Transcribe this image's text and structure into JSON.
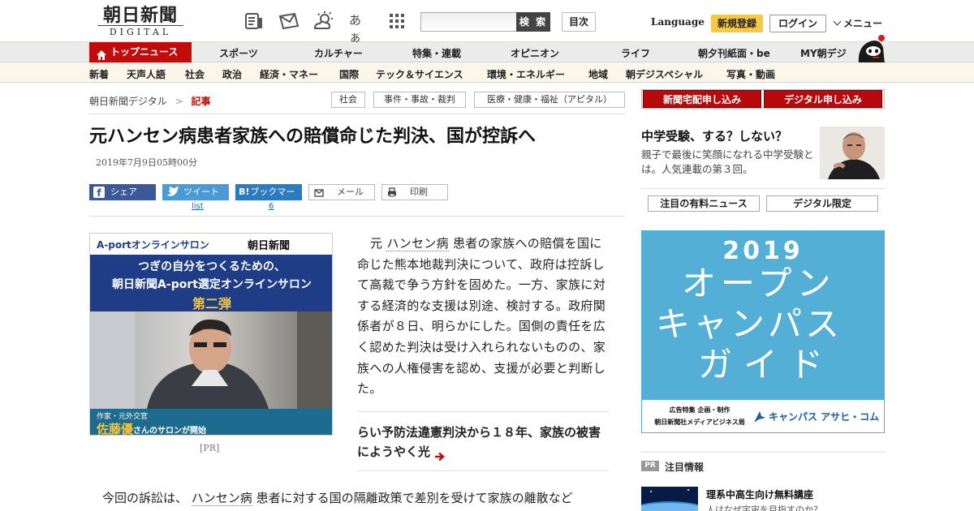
{
  "brand": {
    "logo_main": "朝日新聞",
    "logo_sub": "DIGITAL"
  },
  "header": {
    "icons": [
      "newspaper-icon",
      "mail-icon",
      "weather-icon",
      "font-size-icon",
      "grid-icon"
    ],
    "font_glyph": "あぁ",
    "search_placeholder": "",
    "search_label": "検 索",
    "toc_label": "目次",
    "language_label": "Language",
    "signup_label": "新規登録",
    "login_label": "ログイン",
    "menu_label": "メニュー"
  },
  "nav_primary": {
    "top_label": "トップニュース",
    "items": [
      "スポーツ",
      "カルチャー",
      "特集・連載",
      "オピニオン",
      "ライフ",
      "朝夕刊紙面・be",
      "MY朝デジ"
    ]
  },
  "nav_secondary": {
    "items": [
      "新着",
      "天声人語",
      "社会",
      "政治",
      "経済・マネー",
      "国際",
      "テック＆サイエンス",
      "環境・エネルギー",
      "地域",
      "朝デジスペシャル",
      "写真・動画"
    ]
  },
  "breadcrumb": {
    "home": "朝日新聞デジタル",
    "sep": ">",
    "current": "記事"
  },
  "tags": [
    "社会",
    "事件・事故・裁判",
    "医療・健康・福祉（アピタル）"
  ],
  "article": {
    "headline": "元ハンセン病患者家族への賠償命じた判決、国が控訴へ",
    "date": "2019年7月9日05時00分",
    "share": {
      "facebook": "シェア",
      "twitter": "ツイート",
      "twitter_sub": "list",
      "hatena": "ブックマーク",
      "hatena_badge": "B!",
      "hatena_sub": "6",
      "mail": "メール",
      "print": "印刷"
    },
    "body_pre": "元",
    "body_keyword": "ハンセン病",
    "body_rest": "患者の家族への賠償を国に命じた熊本地裁判決について、政府は控訴して高裁で争う方針を固めた。一方、家族に対する経済的な支援は別途、検討する。政府関係者が８日、明らかにした。国側の責任を広く認めた判決は受け入れられないものの、家族への人権侵害を認め、支援が必要と判断した。",
    "related": "らい予防法違憲判決から１８年、家族の被害にようやく光",
    "para2_pre": "今回の訴訟は、",
    "para2_keyword": "ハンセン病",
    "para2_rest": "患者に対する国の隔離政策で差別を受けて家族の離散など"
  },
  "ad_left": {
    "brand_left": "A-portオンラインサロン",
    "brand_right": "朝日新聞",
    "line1": "つぎの自分をつくるための、",
    "line2": "朝日新聞A-port選定オンラインサロン",
    "line3": "第二弾",
    "caption_small": "作家・元外交官",
    "caption_name": "佐藤優",
    "caption_rest": "さんのサロンが開始",
    "pr_label": "[PR]"
  },
  "sidebar": {
    "btn1": "新聞宅配申し込み",
    "btn2": "デジタル申し込み",
    "feature_title": "中学受験、する？しない？",
    "feature_desc": "親子で最後に笑顔になれる中学受験とは。人気連載の第３回。",
    "tab1": "注目の有料ニュース",
    "tab2": "デジタル限定",
    "ad": {
      "year": "2019",
      "line1": "オープン",
      "line2": "キャンパス",
      "line3": "ガイド",
      "foot1": "広告特集 企画・制作",
      "foot2": "朝日新聞社メディアビジネス局",
      "foot_brand": "キャンパス アサヒ・コム"
    },
    "pr_tag": "PR",
    "section_label": "注目情報",
    "promo_title": "理系中高生向け無料講座",
    "promo_sub": "人はなぜ宇宙を目指すのか？"
  },
  "colors": {
    "brand_red": "#c20b0b",
    "signup_yellow": "#f7c843",
    "ad_blue": "#53afd6",
    "ad_navy": "#1e3d86"
  }
}
